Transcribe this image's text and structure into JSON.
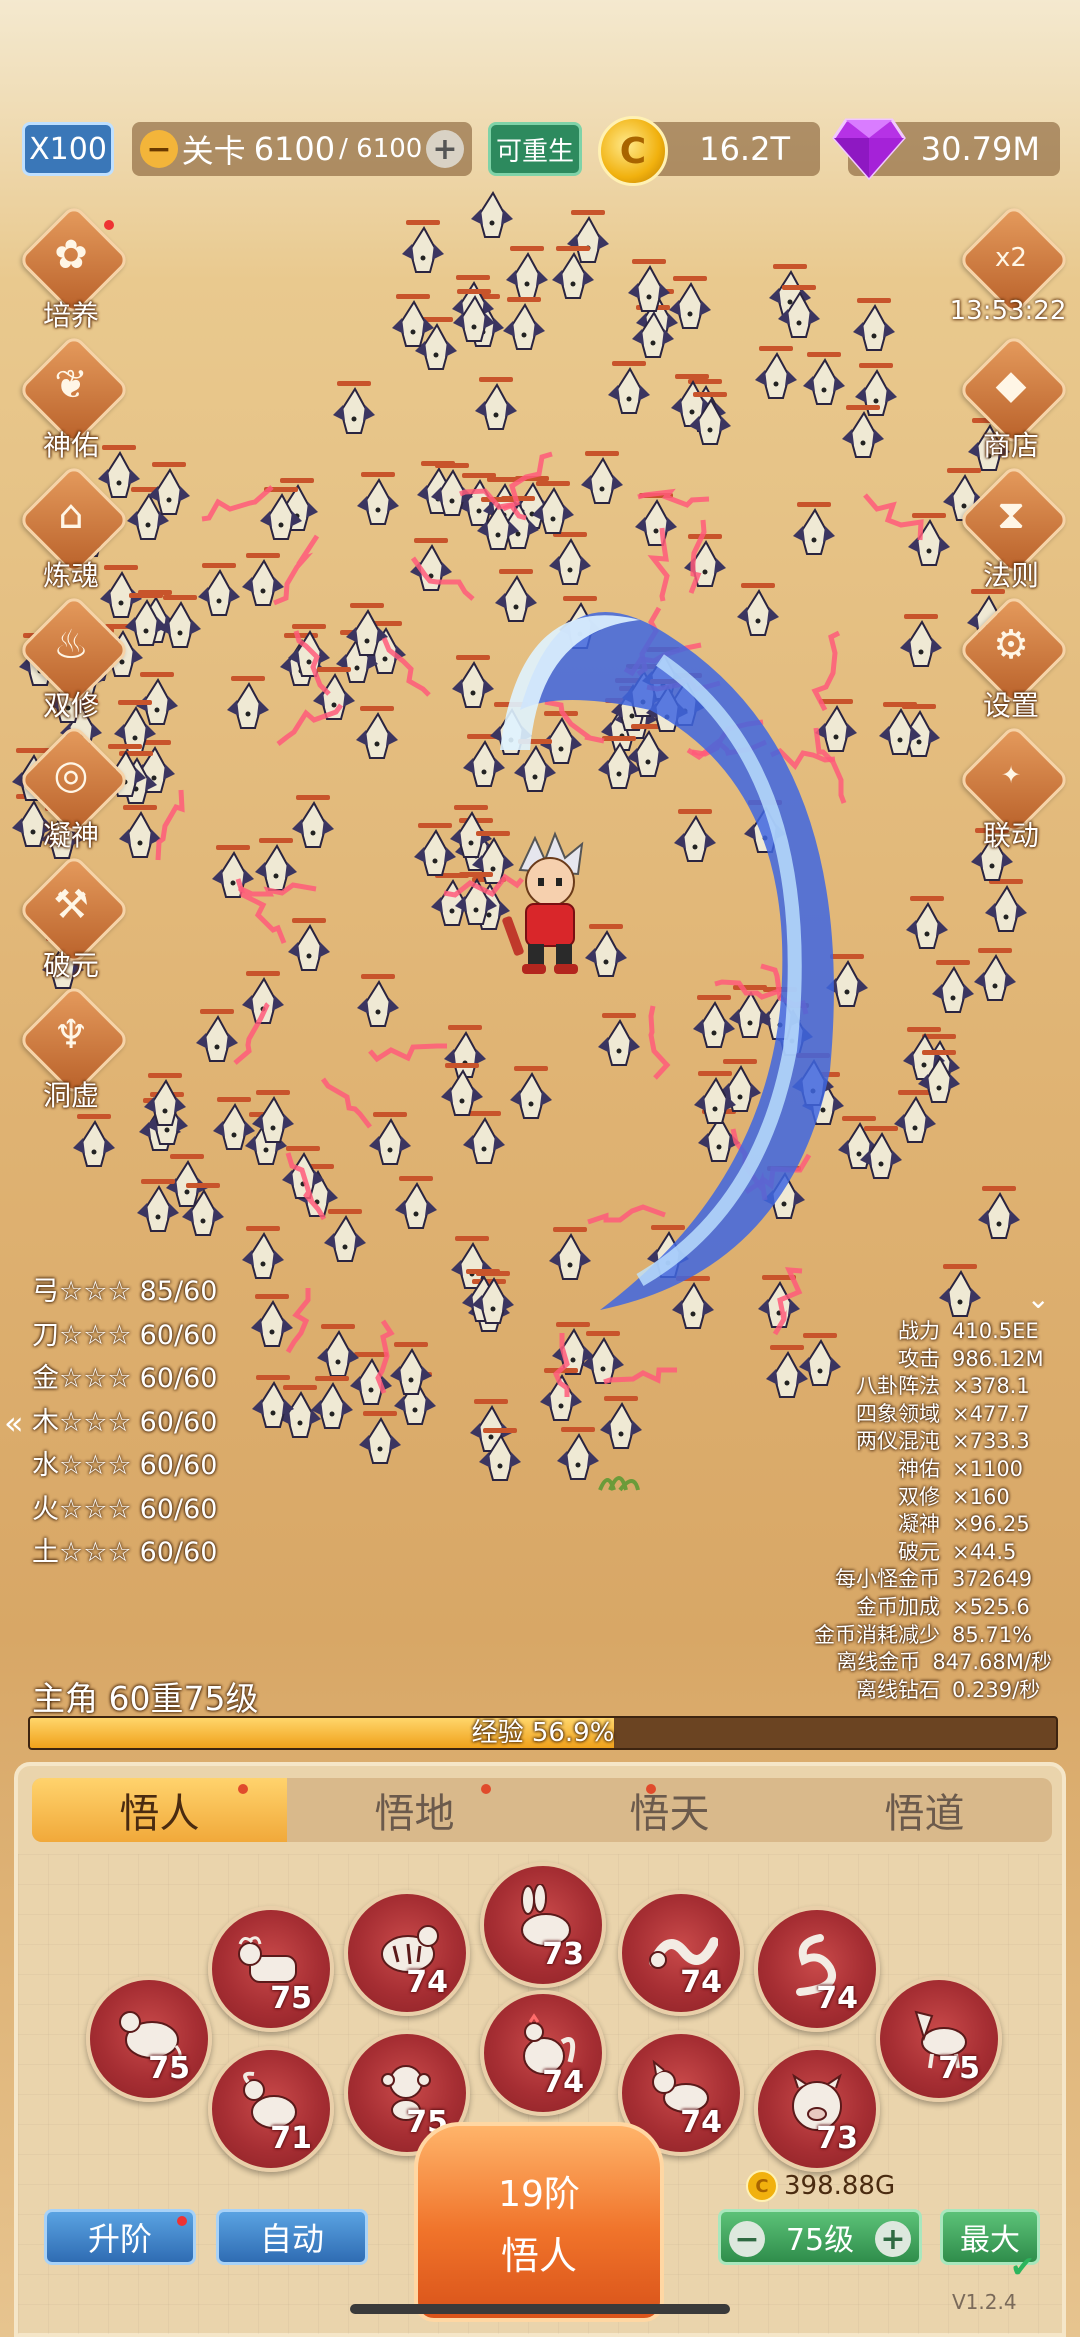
{
  "topbar": {
    "multiplier": "X100",
    "level_label": "关卡",
    "level_current": "6100",
    "level_max": "/ 6100",
    "rebirth": "可重生",
    "coins": "16.2T",
    "gems": "30.79M"
  },
  "left_menu": [
    {
      "label": "培养",
      "icon": "cultivate-icon"
    },
    {
      "label": "神佑",
      "icon": "wings-icon"
    },
    {
      "label": "炼魂",
      "icon": "house-icon"
    },
    {
      "label": "双修",
      "icon": "fire-icon"
    },
    {
      "label": "凝神",
      "icon": "target-icon"
    },
    {
      "label": "破元",
      "icon": "hammer-icon"
    },
    {
      "label": "洞虚",
      "icon": "flame-icon"
    }
  ],
  "right_menu": {
    "bonus_label": "x2",
    "bonus_timer": "13:53:22",
    "shop": "商店",
    "law": "法则",
    "settings": "设置",
    "collab": "联动"
  },
  "weapons": [
    {
      "name": "弓",
      "stars": "☆☆☆",
      "value": "85/60"
    },
    {
      "name": "刀",
      "stars": "☆☆☆",
      "value": "60/60"
    },
    {
      "name": "金",
      "stars": "☆☆☆",
      "value": "60/60"
    },
    {
      "name": "木",
      "stars": "☆☆☆",
      "value": "60/60"
    },
    {
      "name": "水",
      "stars": "☆☆☆",
      "value": "60/60"
    },
    {
      "name": "火",
      "stars": "☆☆☆",
      "value": "60/60"
    },
    {
      "name": "土",
      "stars": "☆☆☆",
      "value": "60/60"
    }
  ],
  "stats": [
    {
      "k": "战力",
      "v": "410.5EE"
    },
    {
      "k": "攻击",
      "v": "986.12M"
    },
    {
      "k": "八卦阵法",
      "v": "×378.1"
    },
    {
      "k": "四象领域",
      "v": "×477.7"
    },
    {
      "k": "两仪混沌",
      "v": "×733.3"
    },
    {
      "k": "神佑",
      "v": "×1100"
    },
    {
      "k": "双修",
      "v": "×160"
    },
    {
      "k": "凝神",
      "v": "×96.25"
    },
    {
      "k": "破元",
      "v": "×44.5"
    },
    {
      "k": "每小怪金币",
      "v": "372649"
    },
    {
      "k": "金币加成",
      "v": "×525.6"
    },
    {
      "k": "金币消耗减少",
      "v": "85.71%"
    },
    {
      "k": "离线金币",
      "v": "847.68M/秒"
    },
    {
      "k": "离线钻石",
      "v": "0.239/秒"
    }
  ],
  "hero": {
    "level_text": "主角 60重75级",
    "exp_text": "经验 56.9%",
    "exp_progress": 0.569
  },
  "tabs": [
    "悟人",
    "悟地",
    "悟天",
    "悟道"
  ],
  "zodiac": [
    {
      "name": "rat",
      "level": "75"
    },
    {
      "name": "ox",
      "level": "75"
    },
    {
      "name": "goat",
      "level": "71"
    },
    {
      "name": "tiger",
      "level": "74"
    },
    {
      "name": "monkey",
      "level": "75"
    },
    {
      "name": "rabbit",
      "level": "73"
    },
    {
      "name": "rooster",
      "level": "74"
    },
    {
      "name": "dragon",
      "level": "74"
    },
    {
      "name": "dog",
      "level": "74"
    },
    {
      "name": "snake",
      "level": "74"
    },
    {
      "name": "pig",
      "level": "73"
    },
    {
      "name": "horse",
      "level": "75"
    }
  ],
  "bottom": {
    "upgrade": "升阶",
    "auto": "自动",
    "stage_line1": "19阶",
    "stage_line2": "悟人",
    "cost": "398.88G",
    "level_value": "75级",
    "max": "最大",
    "version": "V1.2.4"
  },
  "colors": {
    "accent_orange": "#f0732a",
    "exp_fill": "#f0a11b",
    "zodiac_red": "#a62e33",
    "button_blue": "#2f6cb3",
    "button_green": "#2f8d4b"
  }
}
